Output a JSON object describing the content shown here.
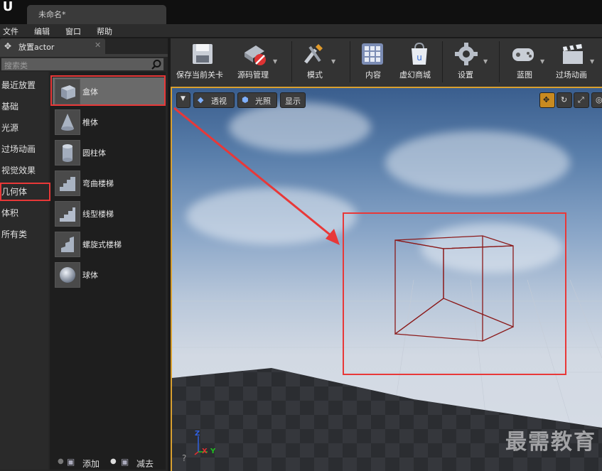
{
  "window": {
    "logo": "U",
    "doc_tab": "未命名*"
  },
  "menu": [
    "文件",
    "编辑",
    "窗口",
    "帮助"
  ],
  "place_panel": {
    "title": "放置actor",
    "search_placeholder": "搜索类",
    "categories": [
      "最近放置",
      "基础",
      "光源",
      "过场动画",
      "视觉效果",
      "几何体",
      "体积",
      "所有类"
    ],
    "items": [
      "盒体",
      "椎体",
      "圆柱体",
      "弯曲楼梯",
      "线型楼梯",
      "螺旋式楼梯",
      "球体"
    ],
    "selected_item": "盒体",
    "selected_category": "几何体",
    "add_label": "添加",
    "subtract_label": "减去"
  },
  "toolbar": {
    "buttons": [
      "保存当前关卡",
      "源码管理",
      "模式",
      "内容",
      "虚幻商城",
      "设置",
      "蓝图",
      "过场动画"
    ]
  },
  "viewport": {
    "perspective_label": "透视",
    "lit_label": "光照",
    "show_label": "显示",
    "axis_z": "Z",
    "axis_x": "X",
    "axis_y": "Y"
  },
  "watermark": "最需教育",
  "colors": {
    "highlight": "#e83838",
    "selection_wire": "#8b1a1a",
    "viewport_border": "#d9a030"
  }
}
